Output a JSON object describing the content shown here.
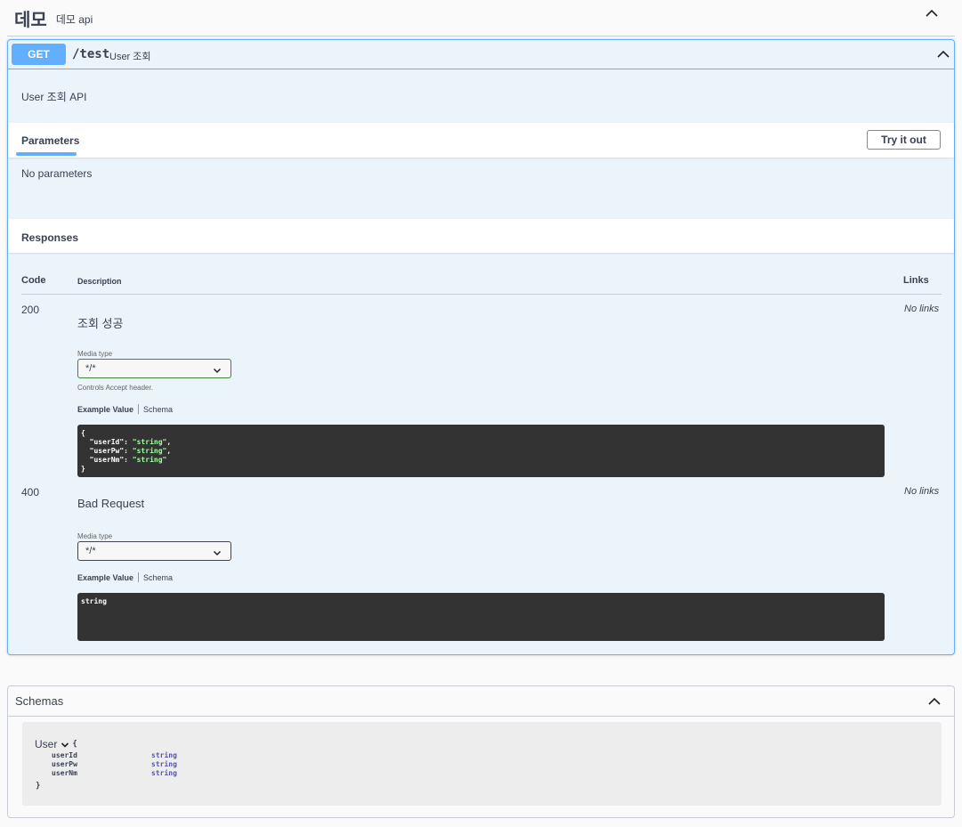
{
  "tag": {
    "name": "데모",
    "description": "데모 api"
  },
  "operation": {
    "method": "GET",
    "path": "/test",
    "summary": "User 조회",
    "description": "User 조회 API",
    "parameters": {
      "title": "Parameters",
      "try_button": "Try it out",
      "empty_text": "No parameters"
    },
    "responses": {
      "title": "Responses",
      "headers": {
        "code": "Code",
        "description": "Description",
        "links": "Links"
      },
      "items": [
        {
          "code": "200",
          "description": "조회 성공",
          "links": "No links",
          "media_type_label": "Media type",
          "media_type_value": "*/*",
          "controls_text": "Controls Accept header.",
          "example_tab": "Example Value",
          "schema_tab": "Schema",
          "example_lines": [
            "{",
            "  \"userId\": ",
            "\"string\"",
            ",",
            "  \"userPw\": ",
            "\"string\"",
            ",",
            "  \"userNm\": ",
            "\"string\"",
            "}"
          ]
        },
        {
          "code": "400",
          "description": "Bad Request",
          "links": "No links",
          "media_type_label": "Media type",
          "media_type_value": "*/*",
          "example_tab": "Example Value",
          "schema_tab": "Schema",
          "example_text": "string"
        }
      ]
    }
  },
  "schemas": {
    "title": "Schemas",
    "model": {
      "name": "User",
      "open_brace": "{",
      "close_brace": "}",
      "properties": [
        {
          "name": "userId",
          "type": "string"
        },
        {
          "name": "userPw",
          "type": "string"
        },
        {
          "name": "userNm",
          "type": "string"
        }
      ]
    }
  },
  "colors": {
    "get": "#61affe",
    "get_bg": "#ebf3fb",
    "code_bg": "#333333",
    "code_string": "#a2fca2"
  },
  "icons": [
    "chevron-up-icon",
    "chevron-down-icon"
  ]
}
